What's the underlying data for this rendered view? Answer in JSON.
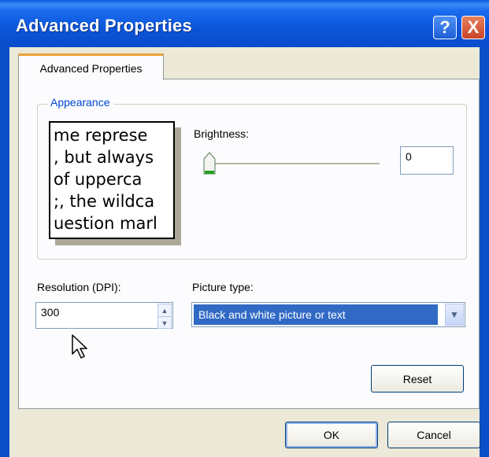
{
  "window": {
    "title": "Advanced Properties",
    "help_label": "?",
    "close_label": "X"
  },
  "tab": {
    "label": "Advanced Properties"
  },
  "appearance": {
    "legend": "Appearance",
    "preview_lines": [
      "me represe",
      ", but always",
      " of upperca",
      ";, the wildca",
      "uestion marl"
    ],
    "brightness_label": "Brightness:",
    "brightness_value": "0",
    "brightness_level": 0.0
  },
  "resolution": {
    "label": "Resolution (DPI):",
    "value": "300"
  },
  "picture_type": {
    "label": "Picture type:",
    "selected": "Black and white picture or text"
  },
  "buttons": {
    "reset": "Reset",
    "ok": "OK",
    "cancel": "Cancel"
  },
  "colors": {
    "title_bar": "#0b55d9",
    "selection": "#316ac5",
    "group_legend": "#0046d5"
  }
}
